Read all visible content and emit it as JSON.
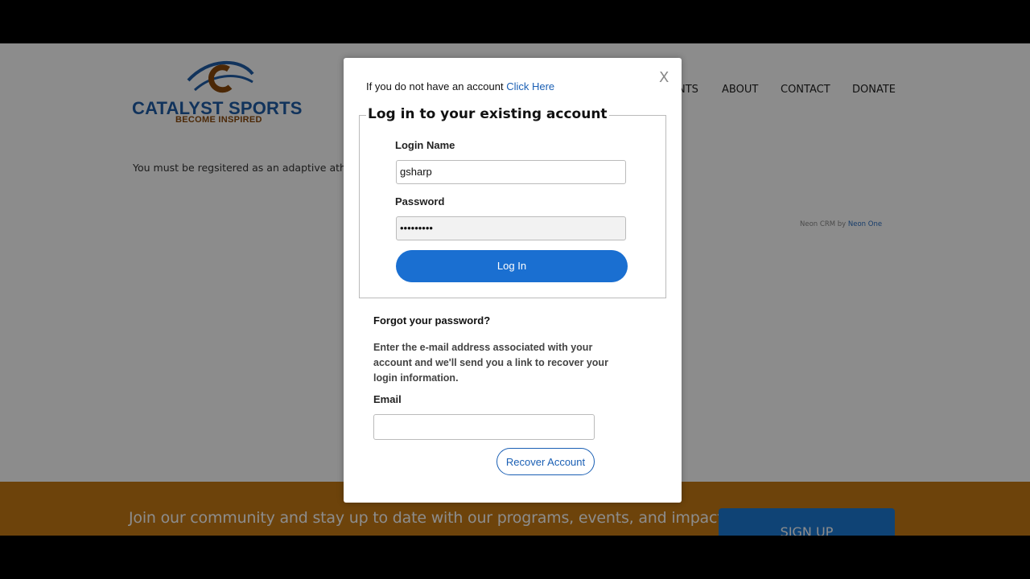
{
  "site": {
    "logo_text": "CATALYST SPORTS",
    "logo_tagline": "BECOME INSPIRED",
    "nav": [
      {
        "label": "NTS"
      },
      {
        "label": "ABOUT"
      },
      {
        "label": "CONTACT"
      },
      {
        "label": "DONATE"
      }
    ],
    "notice": "You must be regsitered as an adaptive athlete t",
    "powered_prefix": "Neon CRM by ",
    "powered_link": "Neon One",
    "footer_text": "Join our community and stay up to date with our programs, events, and impact.",
    "signup_label": "SIGN UP"
  },
  "modal": {
    "close_label": "X",
    "no_account_text": "If you do not have an account ",
    "click_here": "Click Here",
    "legend": "Log in to your existing account",
    "login_name_label": "Login Name",
    "login_name_value": "gsharp",
    "password_label": "Password",
    "password_value": "•••••••••",
    "login_button": "Log In",
    "forgot_title": "Forgot your password?",
    "forgot_body": "Enter the e-mail address associated with your account and we'll send you a link to recover your login information.",
    "email_label": "Email",
    "email_value": "",
    "recover_button": "Recover Account"
  },
  "colors": {
    "brand_blue": "#1a6fd1",
    "footer_orange": "#c77a14"
  }
}
